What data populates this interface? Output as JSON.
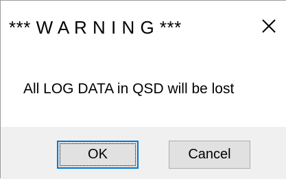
{
  "dialog": {
    "title": "*** W A R N I N G ***",
    "message": "All LOG DATA in QSD will be lost",
    "close_icon": "close-x-icon",
    "buttons": {
      "ok_label": "OK",
      "cancel_label": "Cancel"
    },
    "focused_button": "ok",
    "colors": {
      "background": "#ffffff",
      "footer_background": "#f0f0f0",
      "button_face": "#e1e1e1",
      "focus_border": "#0078d7"
    }
  }
}
